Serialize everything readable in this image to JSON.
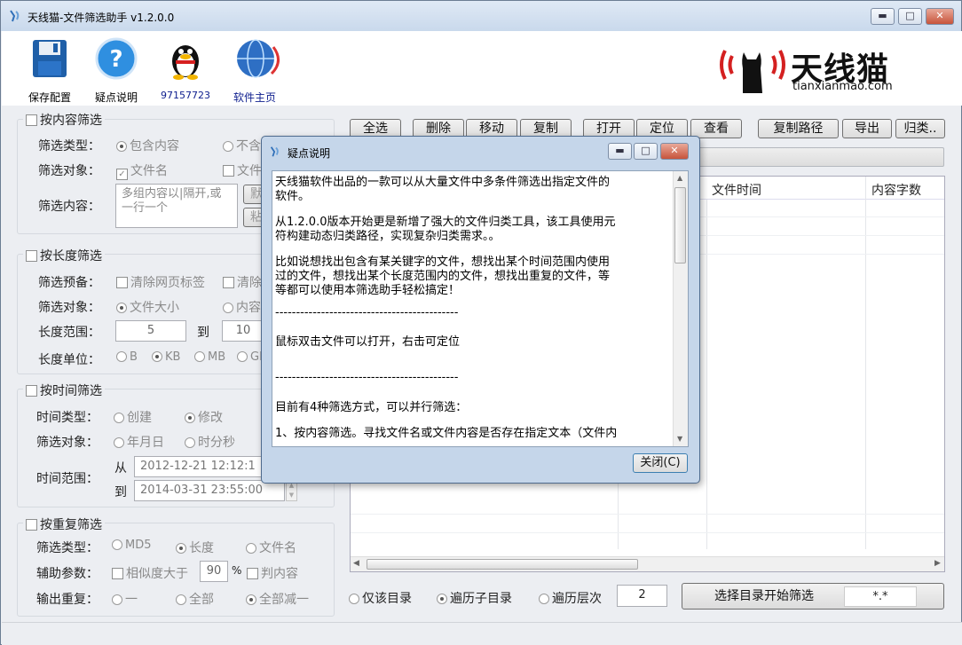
{
  "window": {
    "title": "天线猫-文件筛选助手 v1.2.0.0",
    "min": "▬",
    "max": "□",
    "close": "✕"
  },
  "toolbar": {
    "save": "保存配置",
    "help": "疑点说明",
    "qq": "97157723",
    "home": "软件主页"
  },
  "logo": {
    "name": "天线猫",
    "url": "tianxianmao.com"
  },
  "content_filter": {
    "title": "按内容筛选",
    "type_label": "筛选类型：",
    "type_opt1": "包含内容",
    "type_opt2": "不含",
    "target_label": "筛选对象：",
    "target_opt1": "文件名",
    "target_opt2": "文件",
    "content_label": "筛选内容：",
    "content_placeholder": "多组内容以|隔开,或一行一个",
    "default_btn": "默",
    "paste_btn": "粘"
  },
  "length_filter": {
    "title": "按长度筛选",
    "prep_label": "筛选预备：",
    "prep_opt1": "清除网页标签",
    "prep_opt2": "清除",
    "target_label": "筛选对象：",
    "target_opt1": "文件大小",
    "target_opt2": "内容",
    "range_label": "长度范围：",
    "range_from": "5",
    "range_to_label": "到",
    "range_to": "10",
    "unit_label": "长度单位：",
    "unit_b": "B",
    "unit_kb": "KB",
    "unit_mb": "MB",
    "unit_gb": "GB"
  },
  "time_filter": {
    "title": "按时间筛选",
    "type_label": "时间类型：",
    "type_create": "创建",
    "type_modify": "修改",
    "target_label": "筛选对象：",
    "target_ymd": "年月日",
    "target_hms": "时分秒",
    "range_label": "时间范围：",
    "from_label": "从",
    "from_value": "2012-12-21 12:12:1",
    "to_label": "到",
    "to_value": "2014-03-31 23:55:00"
  },
  "dup_filter": {
    "title": "按重复筛选",
    "type_label": "筛选类型：",
    "type_md5": "MD5",
    "type_length": "长度",
    "type_name": "文件名",
    "aux_label": "辅助参数：",
    "similar_label": "相似度大于",
    "similar_value": "90",
    "percent": "%",
    "judge_content": "判内容",
    "output_label": "输出重复：",
    "out_one": "一",
    "out_all": "全部",
    "out_all_minus": "全部减一"
  },
  "actions": {
    "select_all": "全选",
    "delete": "删除",
    "move": "移动",
    "copy": "复制",
    "open": "打开",
    "locate": "定位",
    "view": "查看",
    "copy_path": "复制路径",
    "export": "导出",
    "classify": "归类.."
  },
  "grid": {
    "col_time": "文件时间",
    "col_words": "内容字数"
  },
  "bottom": {
    "only_dir": "仅该目录",
    "sub_dirs": "遍历子目录",
    "depth_label": "遍历层次",
    "depth_value": "2",
    "start_btn": "选择目录开始筛选",
    "pattern": "*.*"
  },
  "dialog": {
    "title": "疑点说明",
    "close_btn": "关闭(C)",
    "lines": [
      "天线猫软件出品的一款可以从大量文件中多条件筛选出指定文件的",
      "软件。",
      "从1.2.0.0版本开始更是新增了强大的文件归类工具，该工具使用元",
      "符构建动态归类路径，实现复杂归类需求。。",
      "比如说想找出包含有某关键字的文件，想找出某个时间范围内使用",
      "过的文件，想找出某个长度范围内的文件，想找出重复的文件，等",
      "等都可以使用本筛选助手轻松搞定！",
      "--------------------------------------------",
      "鼠标双击文件可以打开，右击可定位",
      "--------------------------------------------",
      "目前有4种筛选方式，可以并行筛选：",
      "1、按内容筛选。寻找文件名或文件内容是否存在指定文本（文件内"
    ]
  }
}
